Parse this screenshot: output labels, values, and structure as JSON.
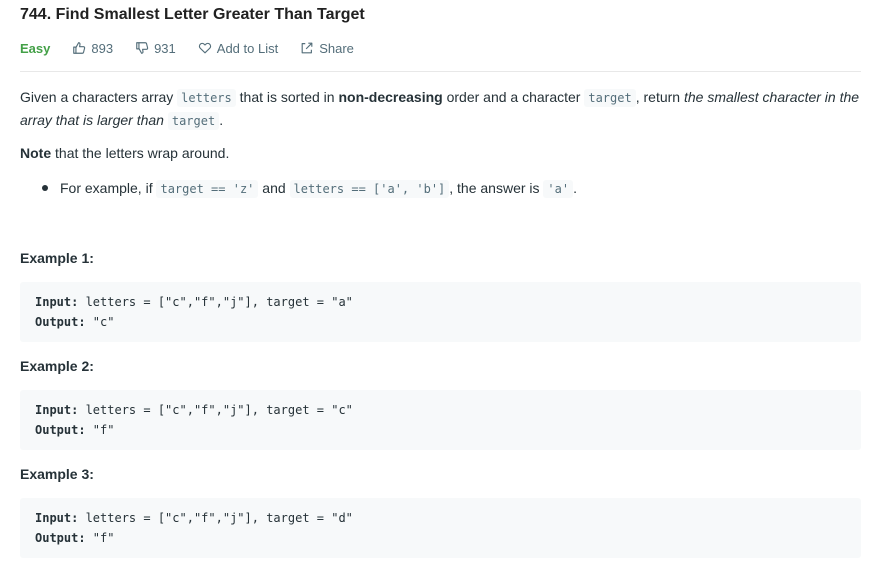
{
  "problem": {
    "title": "744. Find Smallest Letter Greater Than Target",
    "difficulty": "Easy",
    "likes": "893",
    "dislikes": "931",
    "add_to_list": "Add to List",
    "share": "Share"
  },
  "colors": {
    "easy": "#43a047",
    "text": "#263238",
    "muted": "#546e7a",
    "code_bg": "#f7f9fa"
  },
  "description": {
    "p1_a": "Given a characters array ",
    "p1_code1": "letters",
    "p1_b": " that is sorted in ",
    "p1_bold": "non-decreasing",
    "p1_c": " order and a character ",
    "p1_code2": "target",
    "p1_d": ", return ",
    "p1_italic": "the smallest character in the array that is larger than",
    "p1_e": " ",
    "p1_code3": "target",
    "p1_f": ".",
    "p2_bold": "Note",
    "p2_rest": " that the letters wrap around.",
    "bullet_a": "For example, if ",
    "bullet_code1": "target == 'z'",
    "bullet_b": " and ",
    "bullet_code2": "letters == ['a', 'b']",
    "bullet_c": ", the answer is ",
    "bullet_code3": "'a'",
    "bullet_d": "."
  },
  "examples": [
    {
      "heading": "Example 1:",
      "input_label": "Input:",
      "input_value": " letters = [\"c\",\"f\",\"j\"], target = \"a\"",
      "output_label": "Output:",
      "output_value": " \"c\""
    },
    {
      "heading": "Example 2:",
      "input_label": "Input:",
      "input_value": " letters = [\"c\",\"f\",\"j\"], target = \"c\"",
      "output_label": "Output:",
      "output_value": " \"f\""
    },
    {
      "heading": "Example 3:",
      "input_label": "Input:",
      "input_value": " letters = [\"c\",\"f\",\"j\"], target = \"d\"",
      "output_label": "Output:",
      "output_value": " \"f\""
    }
  ]
}
